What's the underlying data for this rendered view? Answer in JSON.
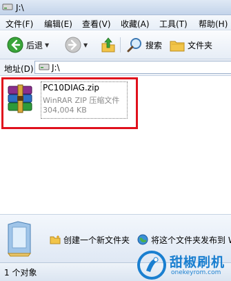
{
  "window": {
    "title": "J:\\"
  },
  "menu": {
    "items": [
      "文件(F)",
      "编辑(E)",
      "查看(V)",
      "收藏(A)",
      "工具(T)",
      "帮助(H)"
    ]
  },
  "toolbar": {
    "back_label": "后退",
    "search_label": "搜索",
    "folders_label": "文件夹"
  },
  "address": {
    "label": "地址(D)",
    "path": "J:\\"
  },
  "file": {
    "name": "PC10DIAG.zip",
    "type": "WinRAR ZIP 压缩文件",
    "size": "304,004 KB",
    "icon": "winrar-archive-icon"
  },
  "tasks": {
    "create_folder": "创建一个新文件夹",
    "publish_web": "将这个文件夹发布到 W"
  },
  "status": {
    "text": "1 个对象"
  },
  "watermark": {
    "title": "甜椒刷机",
    "url": "onekeyrom.com"
  },
  "colors": {
    "highlight": "#e0101c",
    "accent": "#1a7fd0"
  }
}
